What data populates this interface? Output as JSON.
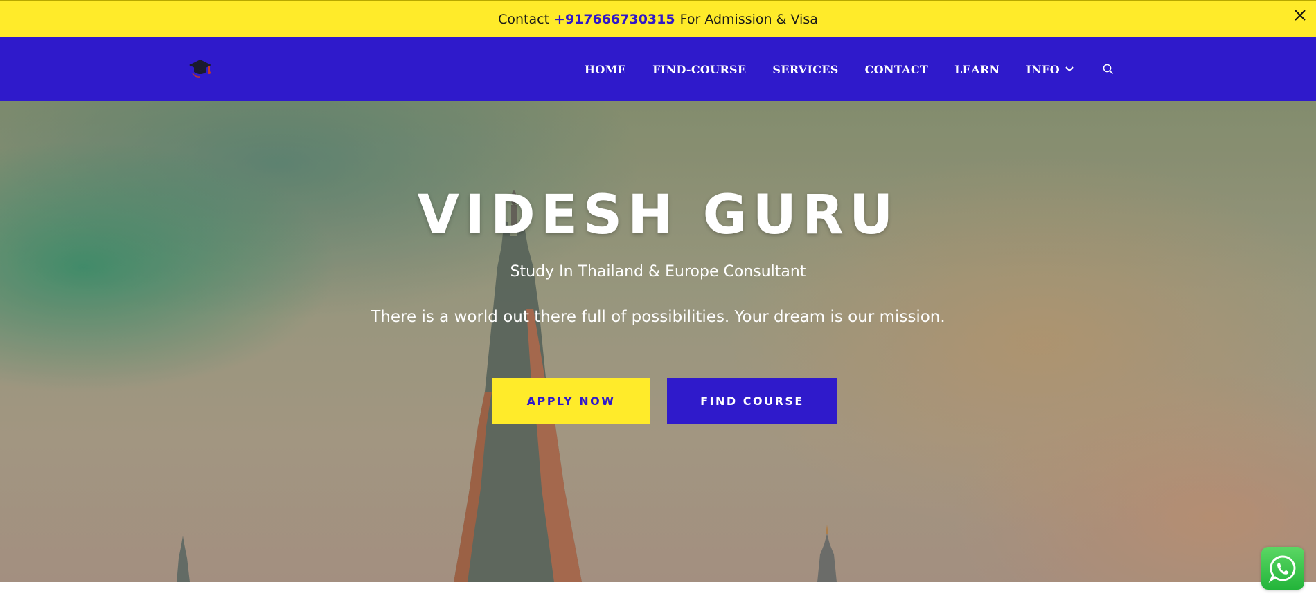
{
  "topbar": {
    "prefix": "Contact",
    "phone": "+917666730315",
    "suffix": "For Admission & Visa",
    "close_icon": "close-icon"
  },
  "nav": {
    "logo_icon": "graduation-cap-icon",
    "items": [
      {
        "label": "HOME"
      },
      {
        "label": "FIND-COURSE"
      },
      {
        "label": "SERVICES"
      },
      {
        "label": "CONTACT"
      },
      {
        "label": "LEARN"
      },
      {
        "label": "INFO",
        "has_dropdown": true
      }
    ],
    "search_icon": "search-icon"
  },
  "hero": {
    "title": "VIDESH GURU",
    "subtitle": "Study In Thailand & Europe Consultant",
    "description": "There is a world out there full of possibilities. Your dream is our mission.",
    "apply_label": "APPLY NOW",
    "find_label": "FIND COURSE"
  },
  "floating": {
    "whatsapp_icon": "whatsapp-icon"
  },
  "colors": {
    "topbar_bg": "#ffeb2a",
    "nav_bg": "#2f1acb",
    "accent_yellow": "#ffeb2a",
    "accent_blue": "#2f1acb",
    "whatsapp_green": "#25d366"
  }
}
